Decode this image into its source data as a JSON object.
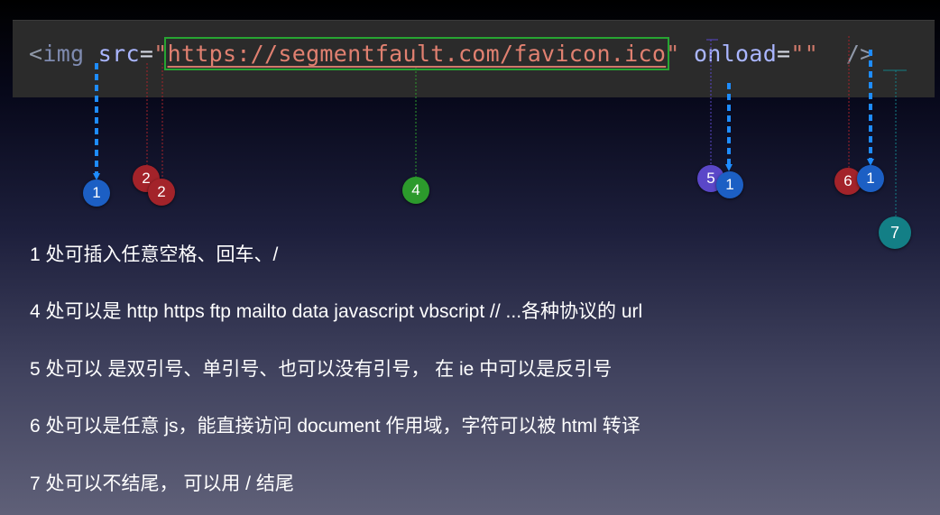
{
  "code": {
    "open_bracket": "<",
    "tag": "img",
    "attr_src": "src",
    "eq1": "=",
    "quote_open": "\"",
    "url": "https://segmentfault.com/favicon.ico",
    "quote_close": "\"",
    "attr_onload": "onload",
    "eq2": "=",
    "quote_empty": "\"\"",
    "close": "/>"
  },
  "markers": {
    "m1a": "1",
    "m2a": "2",
    "m2b": "2",
    "m4": "4",
    "m5": "5",
    "m1b": "1",
    "m6": "6",
    "m1c": "1",
    "m7": "7"
  },
  "notes": [
    "1 处可插入任意空格、回车、/",
    "4 处可以是 http https ftp mailto data javascript vbscript // ...各种协议的 url",
    "5 处可以 是双引号、单引号、也可以没有引号， 在 ie 中可以是反引号",
    "6 处可以是任意 js，能直接访问 document 作用域，字符可以被 html 转译",
    "7 处可以不结尾， 可以用 / 结尾"
  ],
  "colors": {
    "arrow_blue": "#1e8cff",
    "line_red": "#a3232a",
    "line_green": "#2c9a2c",
    "line_purple": "#5a47c8",
    "line_teal": "#137f86",
    "url_box": "#27a432"
  }
}
